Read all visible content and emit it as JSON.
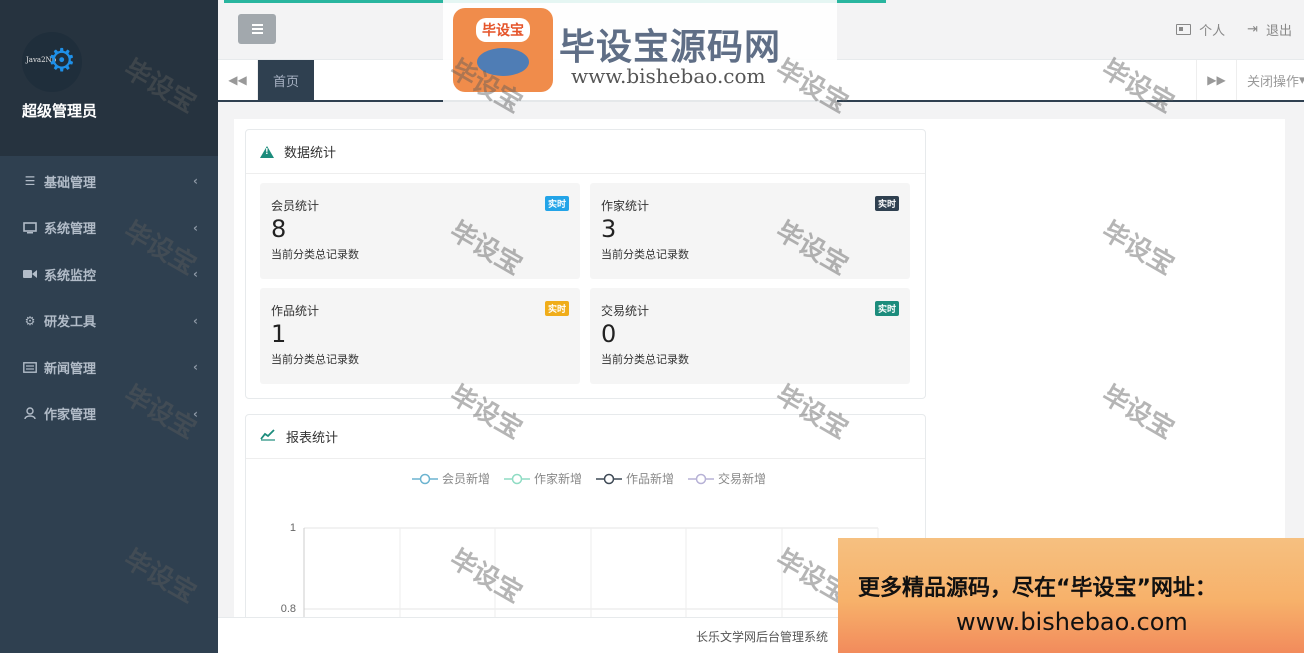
{
  "sidebar": {
    "logo_text": "Java2Nb",
    "admin_name": "超级管理员",
    "items": [
      {
        "label": "基础管理",
        "icon": "menu-icon"
      },
      {
        "label": "系统管理",
        "icon": "monitor-icon"
      },
      {
        "label": "系统监控",
        "icon": "video-icon"
      },
      {
        "label": "研发工具",
        "icon": "gear-icon"
      },
      {
        "label": "新闻管理",
        "icon": "newspaper-icon"
      },
      {
        "label": "作家管理",
        "icon": "user-icon"
      }
    ]
  },
  "header": {
    "personal_label": "个人",
    "logout_label": "退出"
  },
  "tabs": {
    "home_label": "首页",
    "close_label": "关闭操作"
  },
  "stats_panel": {
    "title": "数据统计",
    "cards": [
      {
        "title": "会员统计",
        "value": "8",
        "sub": "当前分类总记录数",
        "badge": "实时",
        "badge_color": "#23a4e8"
      },
      {
        "title": "作家统计",
        "value": "3",
        "sub": "当前分类总记录数",
        "badge": "实时",
        "badge_color": "#2f4050"
      },
      {
        "title": "作品统计",
        "value": "1",
        "sub": "当前分类总记录数",
        "badge": "实时",
        "badge_color": "#f0ad1a"
      },
      {
        "title": "交易统计",
        "value": "0",
        "sub": "当前分类总记录数",
        "badge": "实时",
        "badge_color": "#1c8c7c"
      }
    ]
  },
  "report_panel": {
    "title": "报表统计"
  },
  "chart_data": {
    "type": "line",
    "legend_position": "top-center",
    "series": [
      {
        "name": "会员新增",
        "color": "#6cb4d0"
      },
      {
        "name": "作家新增",
        "color": "#8fdcc4"
      },
      {
        "name": "作品新增",
        "color": "#3f4a56"
      },
      {
        "name": "交易新增",
        "color": "#b7b2d6"
      }
    ],
    "y_ticks": [
      "1",
      "0.8"
    ],
    "grid": true
  },
  "footer": {
    "text": "长乐文学网后台管理系统"
  },
  "watermark": {
    "title": "毕设宝源码网",
    "url": "www.bishebao.com",
    "logo_text": "毕设宝",
    "stamp": "毕设宝"
  },
  "promo": {
    "line1": "更多精品源码，尽在“毕设宝”网址：",
    "line2": "www.bishebao.com"
  },
  "colors": {
    "sidebar_bg": "#2f4050",
    "accent": "#1c8c7c",
    "progress": "#29b59f"
  }
}
